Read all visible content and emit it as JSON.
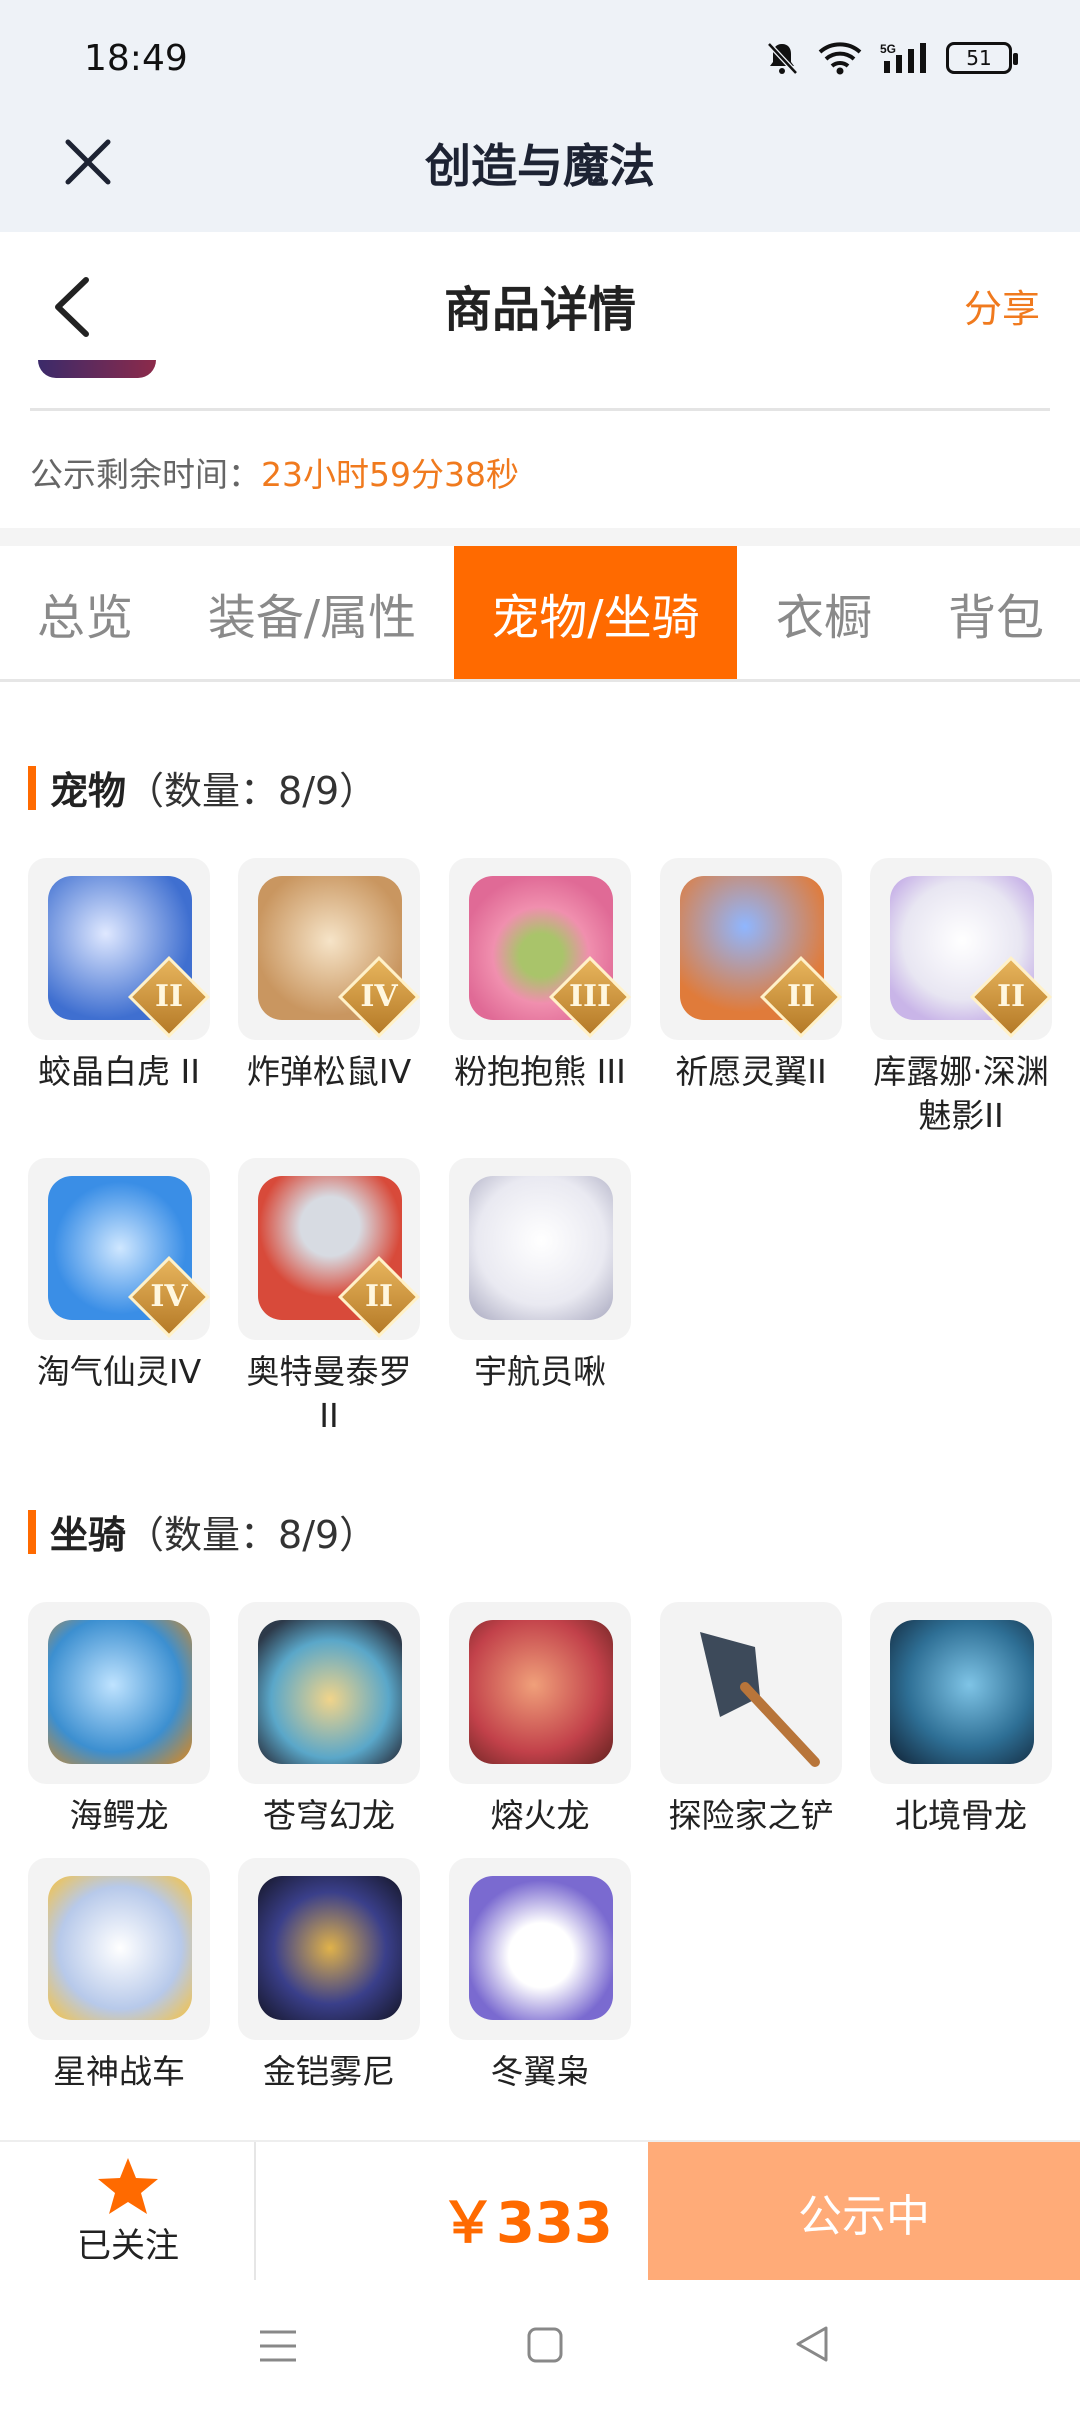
{
  "status_bar": {
    "time": "18:49",
    "battery": "51",
    "network": "5G"
  },
  "app_bar": {
    "title": "创造与魔法"
  },
  "page_header": {
    "title": "商品详情",
    "share": "分享"
  },
  "notice": {
    "label": "公示剩余时间：",
    "value": "23小时59分38秒"
  },
  "tabs": [
    {
      "label": "总览",
      "active": false
    },
    {
      "label": "装备/属性",
      "active": false
    },
    {
      "label": "宠物/坐骑",
      "active": true
    },
    {
      "label": "衣橱",
      "active": false
    },
    {
      "label": "背包",
      "active": false
    }
  ],
  "pets": {
    "title": "宠物",
    "count": "（数量：8/9）",
    "items": [
      {
        "name": "蛟晶白虎 II",
        "rank": "II",
        "color": "#3f6fd0"
      },
      {
        "name": "炸弹松鼠IV",
        "rank": "IV",
        "color": "#c99660"
      },
      {
        "name": "粉抱抱熊 III",
        "rank": "III",
        "color": "#f08fae"
      },
      {
        "name": "祈愿灵翼II",
        "rank": "II",
        "color": "#e07b3a"
      },
      {
        "name": "库露娜·深渊魅影II",
        "rank": "II",
        "color": "#e8e6f2"
      },
      {
        "name": "淘气仙灵IV",
        "rank": "IV",
        "color": "#3a8ee6"
      },
      {
        "name": "奥特曼泰罗II",
        "rank": "II",
        "color": "#d84a3a"
      },
      {
        "name": "宇航员啾",
        "rank": "",
        "color": "#e9e9f1"
      }
    ]
  },
  "mounts": {
    "title": "坐骑",
    "count": "（数量：8/9）",
    "items": [
      {
        "name": "海鳄龙",
        "color": "#3c8fd0"
      },
      {
        "name": "苍穹幻龙",
        "color": "#5aa7c9"
      },
      {
        "name": "熔火龙",
        "color": "#c2414a"
      },
      {
        "name": "探险家之铲",
        "color": "#3d4a5a"
      },
      {
        "name": "北境骨龙",
        "color": "#2e6f95"
      },
      {
        "name": "星神战车",
        "color": "#b7c9ea"
      },
      {
        "name": "金铠雾尼",
        "color": "#3a3f8a"
      },
      {
        "name": "冬翼枭",
        "color": "#7a6ad0"
      }
    ]
  },
  "bottom_bar": {
    "follow_label": "已关注",
    "price": "￥333",
    "status": "公示中"
  },
  "colors": {
    "accent": "#ff6a00",
    "share": "#f07a1e",
    "status_button": "#ffab78"
  }
}
